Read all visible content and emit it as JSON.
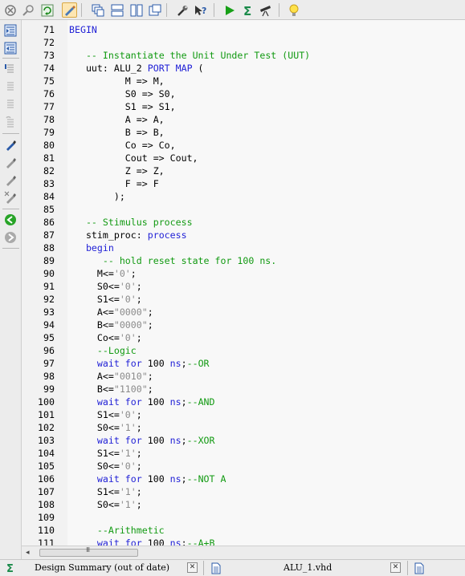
{
  "toolbar": {
    "icons": [
      "cross-probe-icon",
      "find-icon",
      "refresh-icon",
      "edit-highlight-icon",
      "cascade-windows-icon",
      "tile-horizontal-icon",
      "tile-vertical-icon",
      "restore-windows-icon",
      "wrench-icon",
      "context-help-icon",
      "run-icon",
      "sigma-icon",
      "telescope-icon",
      "lightbulb-icon"
    ]
  },
  "sidebar": {
    "icons": [
      "indent-icon",
      "unindent-icon",
      "comment-icon",
      "uncomment-icon",
      "comment-block-icon",
      "uncomment-block-icon",
      "toggle-bookmark-icon",
      "next-bookmark-icon",
      "prev-bookmark-icon",
      "clear-bookmarks-icon",
      "go-forward-icon",
      "go-back-icon"
    ]
  },
  "editor": {
    "lines": [
      {
        "num": "71",
        "segments": [
          {
            "t": "BEGIN",
            "c": "kw"
          }
        ]
      },
      {
        "num": "72",
        "segments": []
      },
      {
        "num": "73",
        "segments": [
          {
            "t": "   "
          },
          {
            "t": "-- Instantiate the Unit Under Test (UUT)",
            "c": "cm"
          }
        ]
      },
      {
        "num": "74",
        "segments": [
          {
            "t": "   uut: ALU_2 "
          },
          {
            "t": "PORT MAP",
            "c": "kw"
          },
          {
            "t": " ("
          }
        ]
      },
      {
        "num": "75",
        "segments": [
          {
            "t": "          M => M,"
          }
        ]
      },
      {
        "num": "76",
        "segments": [
          {
            "t": "          S0 => S0,"
          }
        ]
      },
      {
        "num": "77",
        "segments": [
          {
            "t": "          S1 => S1,"
          }
        ]
      },
      {
        "num": "78",
        "segments": [
          {
            "t": "          A => A,"
          }
        ]
      },
      {
        "num": "79",
        "segments": [
          {
            "t": "          B => B,"
          }
        ]
      },
      {
        "num": "80",
        "segments": [
          {
            "t": "          Co => Co,"
          }
        ]
      },
      {
        "num": "81",
        "segments": [
          {
            "t": "          Cout => Cout,"
          }
        ]
      },
      {
        "num": "82",
        "segments": [
          {
            "t": "          Z => Z,"
          }
        ]
      },
      {
        "num": "83",
        "segments": [
          {
            "t": "          F => F"
          }
        ]
      },
      {
        "num": "84",
        "segments": [
          {
            "t": "        );"
          }
        ]
      },
      {
        "num": "85",
        "segments": []
      },
      {
        "num": "86",
        "segments": [
          {
            "t": "   "
          },
          {
            "t": "-- Stimulus process",
            "c": "cm"
          }
        ]
      },
      {
        "num": "87",
        "segments": [
          {
            "t": "   stim_proc: "
          },
          {
            "t": "process",
            "c": "kw"
          }
        ]
      },
      {
        "num": "88",
        "segments": [
          {
            "t": "   "
          },
          {
            "t": "begin",
            "c": "kw"
          }
        ]
      },
      {
        "num": "89",
        "segments": [
          {
            "t": "      "
          },
          {
            "t": "-- hold reset state for 100 ns.",
            "c": "cm"
          }
        ]
      },
      {
        "num": "90",
        "segments": [
          {
            "t": "     M<="
          },
          {
            "t": "'0'",
            "c": "st"
          },
          {
            "t": ";"
          }
        ]
      },
      {
        "num": "91",
        "segments": [
          {
            "t": "     S0<="
          },
          {
            "t": "'0'",
            "c": "st"
          },
          {
            "t": ";"
          }
        ]
      },
      {
        "num": "92",
        "segments": [
          {
            "t": "     S1<="
          },
          {
            "t": "'0'",
            "c": "st"
          },
          {
            "t": ";"
          }
        ]
      },
      {
        "num": "93",
        "segments": [
          {
            "t": "     A<="
          },
          {
            "t": "\"0000\"",
            "c": "st"
          },
          {
            "t": ";"
          }
        ]
      },
      {
        "num": "94",
        "segments": [
          {
            "t": "     B<="
          },
          {
            "t": "\"0000\"",
            "c": "st"
          },
          {
            "t": ";"
          }
        ]
      },
      {
        "num": "95",
        "segments": [
          {
            "t": "     Co<="
          },
          {
            "t": "'0'",
            "c": "st"
          },
          {
            "t": ";"
          }
        ]
      },
      {
        "num": "96",
        "segments": [
          {
            "t": "     "
          },
          {
            "t": "--Logic",
            "c": "cm"
          }
        ]
      },
      {
        "num": "97",
        "segments": [
          {
            "t": "     "
          },
          {
            "t": "wait for",
            "c": "kw"
          },
          {
            "t": " 100 "
          },
          {
            "t": "ns",
            "c": "kw"
          },
          {
            "t": ";"
          },
          {
            "t": "--OR",
            "c": "cm"
          }
        ]
      },
      {
        "num": "98",
        "segments": [
          {
            "t": "     A<="
          },
          {
            "t": "\"0010\"",
            "c": "st"
          },
          {
            "t": ";"
          }
        ]
      },
      {
        "num": "99",
        "segments": [
          {
            "t": "     B<="
          },
          {
            "t": "\"1100\"",
            "c": "st"
          },
          {
            "t": ";"
          }
        ]
      },
      {
        "num": "100",
        "segments": [
          {
            "t": "     "
          },
          {
            "t": "wait for",
            "c": "kw"
          },
          {
            "t": " 100 "
          },
          {
            "t": "ns",
            "c": "kw"
          },
          {
            "t": ";"
          },
          {
            "t": "--AND",
            "c": "cm"
          }
        ]
      },
      {
        "num": "101",
        "segments": [
          {
            "t": "     S1<="
          },
          {
            "t": "'0'",
            "c": "st"
          },
          {
            "t": ";"
          }
        ]
      },
      {
        "num": "102",
        "segments": [
          {
            "t": "     S0<="
          },
          {
            "t": "'1'",
            "c": "st"
          },
          {
            "t": ";"
          }
        ]
      },
      {
        "num": "103",
        "segments": [
          {
            "t": "     "
          },
          {
            "t": "wait for",
            "c": "kw"
          },
          {
            "t": " 100 "
          },
          {
            "t": "ns",
            "c": "kw"
          },
          {
            "t": ";"
          },
          {
            "t": "--XOR",
            "c": "cm"
          }
        ]
      },
      {
        "num": "104",
        "segments": [
          {
            "t": "     S1<="
          },
          {
            "t": "'1'",
            "c": "st"
          },
          {
            "t": ";"
          }
        ]
      },
      {
        "num": "105",
        "segments": [
          {
            "t": "     S0<="
          },
          {
            "t": "'0'",
            "c": "st"
          },
          {
            "t": ";"
          }
        ]
      },
      {
        "num": "106",
        "segments": [
          {
            "t": "     "
          },
          {
            "t": "wait for",
            "c": "kw"
          },
          {
            "t": " 100 "
          },
          {
            "t": "ns",
            "c": "kw"
          },
          {
            "t": ";"
          },
          {
            "t": "--NOT A",
            "c": "cm"
          }
        ]
      },
      {
        "num": "107",
        "segments": [
          {
            "t": "     S1<="
          },
          {
            "t": "'1'",
            "c": "st"
          },
          {
            "t": ";"
          }
        ]
      },
      {
        "num": "108",
        "segments": [
          {
            "t": "     S0<="
          },
          {
            "t": "'1'",
            "c": "st"
          },
          {
            "t": ";"
          }
        ]
      },
      {
        "num": "109",
        "segments": []
      },
      {
        "num": "110",
        "segments": [
          {
            "t": "     "
          },
          {
            "t": "--Arithmetic",
            "c": "cm"
          }
        ]
      },
      {
        "num": "111",
        "segments": [
          {
            "t": "     "
          },
          {
            "t": "wait for",
            "c": "kw"
          },
          {
            "t": " 100 "
          },
          {
            "t": "ns",
            "c": "kw"
          },
          {
            "t": ";"
          },
          {
            "t": "--A+B",
            "c": "cm"
          }
        ]
      }
    ]
  },
  "scrollbar": {
    "grip": "III"
  },
  "tabs": {
    "design_summary": {
      "label": "Design Summary (out of date)"
    },
    "alu_file": {
      "label": "ALU_1.vhd"
    }
  },
  "colors": {
    "keyword": "#1f1fd6",
    "comment": "#129a12",
    "string": "#8a8a8a"
  }
}
